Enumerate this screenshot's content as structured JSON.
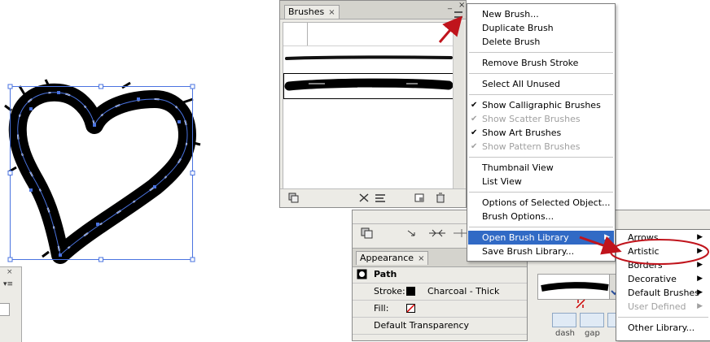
{
  "brushes_panel": {
    "tab_label": "Brushes",
    "close_glyph": "×",
    "minimize_glyph": "_",
    "window_close_glyph": "×"
  },
  "brush_menu": {
    "items": [
      {
        "label": "New Brush...",
        "checked": false,
        "disabled": false
      },
      {
        "label": "Duplicate Brush",
        "checked": false,
        "disabled": false
      },
      {
        "label": "Delete Brush",
        "checked": false,
        "disabled": false
      },
      {
        "label": "Remove Brush Stroke",
        "checked": false,
        "disabled": false
      },
      {
        "label": "Select All Unused",
        "checked": false,
        "disabled": false
      },
      {
        "label": "Show Calligraphic Brushes",
        "checked": true,
        "disabled": false
      },
      {
        "label": "Show Scatter Brushes",
        "checked": true,
        "disabled": true
      },
      {
        "label": "Show Art Brushes",
        "checked": true,
        "disabled": false
      },
      {
        "label": "Show Pattern Brushes",
        "checked": true,
        "disabled": true
      },
      {
        "label": "Thumbnail View",
        "checked": false,
        "disabled": false
      },
      {
        "label": "List View",
        "checked": false,
        "disabled": false
      },
      {
        "label": "Options of Selected Object...",
        "checked": false,
        "disabled": false
      },
      {
        "label": "Brush Options...",
        "checked": false,
        "disabled": false
      },
      {
        "label": "Open Brush Library",
        "checked": false,
        "disabled": false,
        "highlighted": true,
        "submenu": true
      },
      {
        "label": "Save Brush Library...",
        "checked": false,
        "disabled": false
      }
    ],
    "check_glyph": "✔",
    "arrow_glyph": "▶"
  },
  "library_submenu": {
    "items": [
      {
        "label": "Arrows",
        "submenu": true,
        "disabled": false
      },
      {
        "label": "Artistic",
        "submenu": true,
        "disabled": false
      },
      {
        "label": "Borders",
        "submenu": true,
        "disabled": false
      },
      {
        "label": "Decorative",
        "submenu": true,
        "disabled": false
      },
      {
        "label": "Default Brushes",
        "submenu": true,
        "disabled": false
      },
      {
        "label": "User Defined",
        "submenu": true,
        "disabled": true
      },
      {
        "label": "Other Library...",
        "submenu": false,
        "disabled": false
      }
    ]
  },
  "appearance_panel": {
    "tab_label": "Appearance",
    "close_glyph": "×",
    "object_label": "Path",
    "stroke_label": "Stroke:",
    "stroke_value": "Charcoal - Thick",
    "fill_label": "Fill:",
    "transparency_label": "Default Transparency"
  },
  "stroke_panel": {
    "dash_label": "dash",
    "gap_label": "gap"
  },
  "colors": {
    "highlight": "#316ac5",
    "annotation_red": "#c0141c",
    "selection_blue": "#4a73e0"
  }
}
